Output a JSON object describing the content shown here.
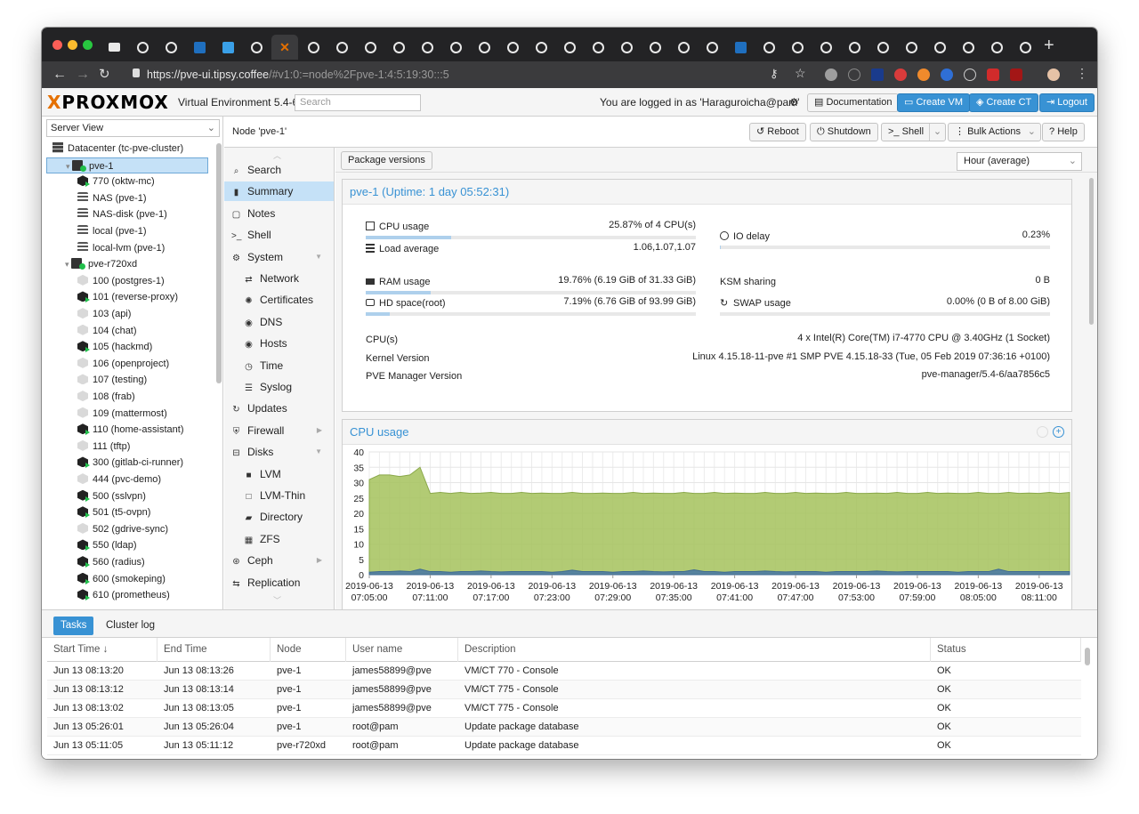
{
  "browser": {
    "url_host": "https://pve-ui.tipsy.coffee",
    "url_path": "/#v1:0:=node%2Fpve-1:4:5:19:30:::5",
    "tab_count": 33
  },
  "app": {
    "logo_x": "X",
    "logo_text": "PROXMOX",
    "version": "Virtual Environment 5.4-6",
    "search_placeholder": "Search",
    "logged_in": "You are logged in as 'Haraguroicha@pam'",
    "documentation": "Documentation",
    "create_vm": "Create VM",
    "create_ct": "Create CT",
    "logout": "Logout"
  },
  "tree": {
    "view": "Server View",
    "items": [
      {
        "label": "Datacenter (tc-pve-cluster)",
        "icon": "datacenter-icon",
        "level": 0
      },
      {
        "label": "pve-1",
        "icon": "server-icon",
        "level": 1
      },
      {
        "label": "770 (oktw-mc)",
        "icon": "container-icon",
        "level": 2
      },
      {
        "label": "NAS (pve-1)",
        "icon": "storage-icon",
        "level": 2
      },
      {
        "label": "NAS-disk (pve-1)",
        "icon": "storage-icon",
        "level": 2
      },
      {
        "label": "local (pve-1)",
        "icon": "storage-icon",
        "level": 2
      },
      {
        "label": "local-lvm (pve-1)",
        "icon": "storage-icon",
        "level": 2
      },
      {
        "label": "pve-r720xd",
        "icon": "server-icon",
        "level": 1
      },
      {
        "label": "100 (postgres-1)",
        "icon": "vm-off-icon",
        "level": 2
      },
      {
        "label": "101 (reverse-proxy)",
        "icon": "vm-running-icon",
        "level": 2
      },
      {
        "label": "103 (api)",
        "icon": "vm-off-icon",
        "level": 2
      },
      {
        "label": "104 (chat)",
        "icon": "vm-off-icon",
        "level": 2
      },
      {
        "label": "105 (hackmd)",
        "icon": "vm-running-icon",
        "level": 2
      },
      {
        "label": "106 (openproject)",
        "icon": "vm-off-icon",
        "level": 2
      },
      {
        "label": "107 (testing)",
        "icon": "vm-off-icon",
        "level": 2
      },
      {
        "label": "108 (frab)",
        "icon": "vm-off-icon",
        "level": 2
      },
      {
        "label": "109 (mattermost)",
        "icon": "vm-off-icon",
        "level": 2
      },
      {
        "label": "110 (home-assistant)",
        "icon": "vm-running-icon",
        "level": 2
      },
      {
        "label": "111 (tftp)",
        "icon": "vm-off-icon",
        "level": 2
      },
      {
        "label": "300 (gitlab-ci-runner)",
        "icon": "vm-running-icon",
        "level": 2
      },
      {
        "label": "444 (pvc-demo)",
        "icon": "vm-off-icon",
        "level": 2
      },
      {
        "label": "500 (sslvpn)",
        "icon": "vm-running-icon",
        "level": 2
      },
      {
        "label": "501 (t5-ovpn)",
        "icon": "vm-running-icon",
        "level": 2
      },
      {
        "label": "502 (gdrive-sync)",
        "icon": "vm-off-icon",
        "level": 2
      },
      {
        "label": "550 (ldap)",
        "icon": "vm-running-icon",
        "level": 2
      },
      {
        "label": "560 (radius)",
        "icon": "vm-running-icon",
        "level": 2
      },
      {
        "label": "600 (smokeping)",
        "icon": "vm-running-icon",
        "level": 2
      },
      {
        "label": "610 (prometheus)",
        "icon": "vm-running-icon",
        "level": 2
      }
    ]
  },
  "node": {
    "title": "Node 'pve-1'",
    "buttons": {
      "reboot": "Reboot",
      "shutdown": "Shutdown",
      "shell": "Shell",
      "bulk": "Bulk Actions",
      "help": "Help"
    }
  },
  "menu": [
    {
      "label": "Search",
      "icon": "search-icon"
    },
    {
      "label": "Summary",
      "icon": "book-icon"
    },
    {
      "label": "Notes",
      "icon": "notes-icon"
    },
    {
      "label": "Shell",
      "icon": "terminal-icon"
    },
    {
      "label": "System",
      "icon": "cogs-icon"
    },
    {
      "label": "Network",
      "icon": "network-icon"
    },
    {
      "label": "Certificates",
      "icon": "certificate-icon"
    },
    {
      "label": "DNS",
      "icon": "globe-icon"
    },
    {
      "label": "Hosts",
      "icon": "globe-icon"
    },
    {
      "label": "Time",
      "icon": "clock-icon"
    },
    {
      "label": "Syslog",
      "icon": "list-icon"
    },
    {
      "label": "Updates",
      "icon": "refresh-icon"
    },
    {
      "label": "Firewall",
      "icon": "shield-icon"
    },
    {
      "label": "Disks",
      "icon": "hdd-icon"
    },
    {
      "label": "LVM",
      "icon": "square-icon"
    },
    {
      "label": "LVM-Thin",
      "icon": "square-outline-icon"
    },
    {
      "label": "Directory",
      "icon": "folder-icon"
    },
    {
      "label": "ZFS",
      "icon": "grid-icon"
    },
    {
      "label": "Ceph",
      "icon": "ceph-icon"
    },
    {
      "label": "Replication",
      "icon": "retweet-icon"
    }
  ],
  "summary": {
    "package_versions": "Package versions",
    "timeframe": "Hour (average)",
    "title": "pve-1 (Uptime: 1 day 05:52:31)",
    "cpu_label": "CPU usage",
    "cpu_value": "25.87% of 4 CPU(s)",
    "cpu_fraction": 0.2587,
    "load_label": "Load average",
    "load_value": "1.06,1.07,1.07",
    "io_label": "IO delay",
    "io_value": "0.23%",
    "io_fraction": 0.0023,
    "ram_label": "RAM usage",
    "ram_value": "19.76% (6.19 GiB of 31.33 GiB)",
    "ram_fraction": 0.1976,
    "ksm_label": "KSM sharing",
    "ksm_value": "0 B",
    "hd_label": "HD space(root)",
    "hd_value": "7.19% (6.76 GiB of 93.99 GiB)",
    "hd_fraction": 0.0719,
    "swap_label": "SWAP usage",
    "swap_value": "0.00% (0 B of 8.00 GiB)",
    "swap_fraction": 0,
    "cpus_label": "CPU(s)",
    "cpus_value": "4 x Intel(R) Core(TM) i7-4770 CPU @ 3.40GHz (1 Socket)",
    "kernel_label": "Kernel Version",
    "kernel_value": "Linux 4.15.18-11-pve #1 SMP PVE 4.15.18-33 (Tue, 05 Feb 2019 07:36:16 +0100)",
    "pve_label": "PVE Manager Version",
    "pve_value": "pve-manager/5.4-6/aa7856c5"
  },
  "cpu_chart_title": "CPU usage",
  "chart_data": {
    "type": "area",
    "title": "CPU usage",
    "ylim": [
      0,
      40
    ],
    "yticks": [
      0,
      5,
      10,
      15,
      20,
      25,
      30,
      35,
      40
    ],
    "grid": true,
    "x_tick_dates": [
      "2019-06-13",
      "2019-06-13",
      "2019-06-13",
      "2019-06-13",
      "2019-06-13",
      "2019-06-13",
      "2019-06-13",
      "2019-06-13",
      "2019-06-13",
      "2019-06-13",
      "2019-06-13",
      "2019-06-13"
    ],
    "x_tick_times": [
      "07:05:00",
      "07:11:00",
      "07:17:00",
      "07:23:00",
      "07:29:00",
      "07:35:00",
      "07:41:00",
      "07:47:00",
      "07:53:00",
      "07:59:00",
      "08:05:00",
      "08:11:00"
    ],
    "x_minutes": [
      0,
      1,
      2,
      3,
      4,
      5,
      6,
      7,
      8,
      9,
      10,
      11,
      12,
      13,
      14,
      15,
      16,
      17,
      18,
      19,
      20,
      21,
      22,
      23,
      24,
      25,
      26,
      27,
      28,
      29,
      30,
      31,
      32,
      33,
      34,
      35,
      36,
      37,
      38,
      39,
      40,
      41,
      42,
      43,
      44,
      45,
      46,
      47,
      48,
      49,
      50,
      51,
      52,
      53,
      54,
      55,
      56,
      57,
      58,
      59,
      60,
      61,
      62,
      63,
      64,
      65,
      66,
      67,
      68,
      69
    ],
    "x_start": "2019-06-13 07:05:00",
    "series": [
      {
        "color": "#a5c25c",
        "values": [
          31,
          32.5,
          32.5,
          32,
          32.5,
          35,
          26.5,
          26.8,
          26.5,
          26.8,
          26.5,
          26.6,
          26.8,
          26.5,
          26.5,
          26.8,
          26.5,
          26.6,
          26.5,
          26.5,
          26.8,
          26.5,
          26.5,
          26.6,
          26.5,
          26.5,
          26.8,
          26.5,
          26.6,
          26.5,
          26.5,
          26.8,
          26.5,
          26.5,
          26.8,
          26.5,
          26.6,
          26.5,
          26.5,
          26.8,
          26.5,
          26.5,
          26.8,
          26.5,
          26.6,
          26.5,
          26.5,
          26.8,
          26.5,
          26.5,
          26.6,
          26.5,
          26.8,
          26.5,
          26.5,
          26.8,
          26.5,
          26.6,
          26.5,
          26.5,
          26.8,
          26.5,
          26.5,
          26.8,
          26.5,
          26.6,
          26.5,
          26.8,
          26.5,
          26.8
        ]
      },
      {
        "color": "#4d7ba3",
        "values": [
          0.8,
          1,
          1,
          1.2,
          1,
          1.8,
          1,
          1,
          0.8,
          1,
          1,
          1.2,
          1,
          0.9,
          1,
          1,
          1,
          1,
          0.8,
          1,
          1.5,
          1,
          1,
          1,
          0.8,
          1,
          1,
          1.2,
          1,
          0.9,
          1,
          1,
          1.6,
          1,
          1,
          0.8,
          1,
          1,
          1,
          1.2,
          1,
          0.9,
          1,
          1,
          1,
          0.8,
          1,
          1,
          1,
          1,
          1.2,
          1,
          0.9,
          1,
          1,
          1,
          1,
          1,
          0.8,
          1,
          1,
          1,
          1.8,
          1,
          1,
          1,
          1,
          1,
          1,
          1
        ]
      }
    ]
  },
  "tasks": {
    "tab_tasks": "Tasks",
    "tab_cluster": "Cluster log",
    "columns": [
      "Start Time ↓",
      "End Time",
      "Node",
      "User name",
      "Description",
      "Status"
    ],
    "rows": [
      [
        "Jun 13 08:13:20",
        "Jun 13 08:13:26",
        "pve-1",
        "james58899@pve",
        "VM/CT 770 - Console",
        "OK"
      ],
      [
        "Jun 13 08:13:12",
        "Jun 13 08:13:14",
        "pve-1",
        "james58899@pve",
        "VM/CT 775 - Console",
        "OK"
      ],
      [
        "Jun 13 08:13:02",
        "Jun 13 08:13:05",
        "pve-1",
        "james58899@pve",
        "VM/CT 775 - Console",
        "OK"
      ],
      [
        "Jun 13 05:26:01",
        "Jun 13 05:26:04",
        "pve-1",
        "root@pam",
        "Update package database",
        "OK"
      ],
      [
        "Jun 13 05:11:05",
        "Jun 13 05:11:12",
        "pve-r720xd",
        "root@pam",
        "Update package database",
        "OK"
      ]
    ]
  }
}
